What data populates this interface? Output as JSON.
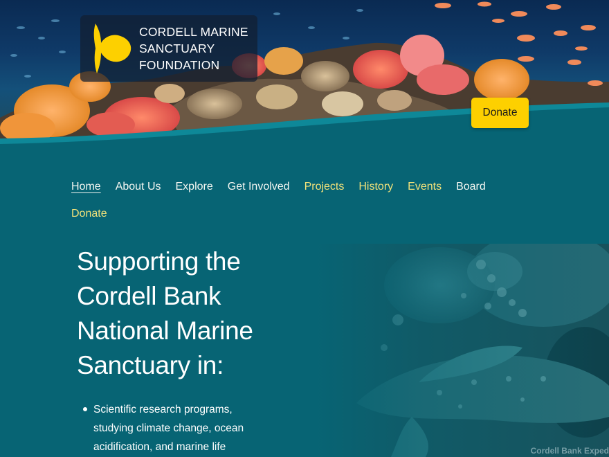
{
  "brand": {
    "name_lines": [
      "CORDELL MARINE",
      "SANCTUARY",
      "FOUNDATION"
    ],
    "logo_icon": "sunfish-icon",
    "accent": "#fdd000"
  },
  "header": {
    "donate_label": "Donate"
  },
  "nav": {
    "items": [
      {
        "label": "Home",
        "color": "white",
        "current": true
      },
      {
        "label": "About Us",
        "color": "white"
      },
      {
        "label": "Explore",
        "color": "white"
      },
      {
        "label": "Get Involved",
        "color": "white"
      },
      {
        "label": "Projects",
        "color": "yellow"
      },
      {
        "label": "History",
        "color": "yellow"
      },
      {
        "label": "Events",
        "color": "yellow"
      },
      {
        "label": "Board",
        "color": "white"
      },
      {
        "label": "Donate",
        "color": "yellow"
      }
    ]
  },
  "main": {
    "heading_lines": [
      "Supporting the",
      "Cordell Bank",
      "National Marine",
      "Sanctuary in:"
    ],
    "bullets": [
      {
        "lines": [
          "Scientific research programs,",
          "studying climate change, ocean",
          "acidification, and marine life"
        ]
      }
    ],
    "photo_caption": "Cordell Bank Exped"
  },
  "colors": {
    "background": "#076474",
    "nav_white": "#f4f7f2",
    "nav_yellow": "#f2e27a"
  }
}
